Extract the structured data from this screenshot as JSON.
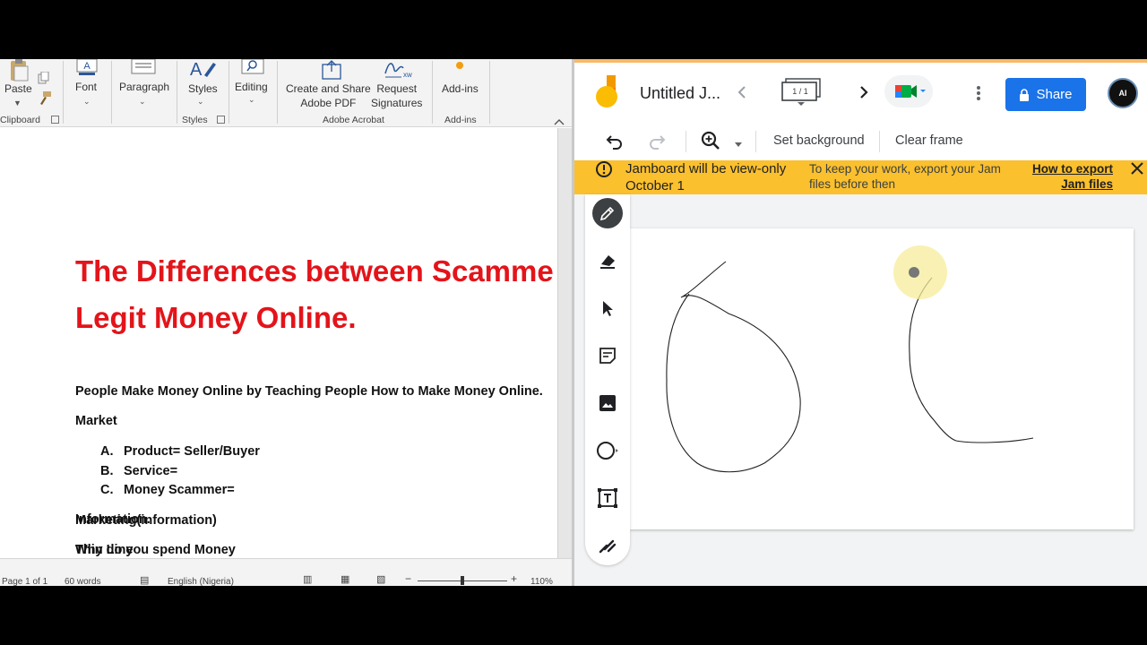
{
  "word": {
    "ribbon": {
      "paste": "Paste",
      "clipboard": "Clipboard",
      "font": "Font",
      "paragraph": "Paragraph",
      "styles": "Styles",
      "styles_group": "Styles",
      "editing": "Editing",
      "create_share_1": "Create and Share",
      "create_share_2": "Adobe PDF",
      "request_1": "Request",
      "request_2": "Signatures",
      "adobe_group": "Adobe Acrobat",
      "addins": "Add-ins",
      "addins_group": "Add-ins"
    },
    "document": {
      "title_line1": "The Differences between Scamme",
      "title_line2": "Legit Money Online.",
      "line1": "People Make Money Online by Teaching People How to Make Money Online.",
      "line2": "Market",
      "list": [
        {
          "marker": "A.",
          "text": "Product= Seller/Buyer"
        },
        {
          "marker": "B.",
          "text": "Service="
        },
        {
          "marker": "C.",
          "text": "Money Scammer="
        }
      ],
      "line3": "Information.",
      "line4": "Thin Line",
      "line5": "Marketing(information)",
      "line6": "Why do you spend Money"
    },
    "status": {
      "page": "Page 1 of 1",
      "words": "60 words",
      "language": "English (Nigeria)",
      "zoom": "110%"
    }
  },
  "jam": {
    "title": "Untitled J...",
    "frame_counter": "1 / 1",
    "share_label": "Share",
    "avatar_text": "AI",
    "toolbar": {
      "set_background": "Set background",
      "clear_frame": "Clear frame"
    },
    "banner": {
      "headline": "Jamboard will be view-only October 1",
      "message": "To keep your work, export your Jam files before then",
      "link": "How to export Jam files"
    },
    "colors": {
      "share_blue": "#1a73e8",
      "banner_yellow": "#fbc02d",
      "title_red": "#e3141a"
    }
  }
}
